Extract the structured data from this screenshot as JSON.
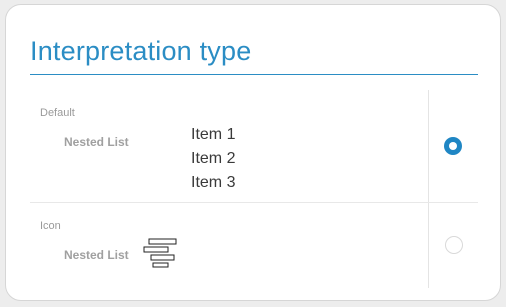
{
  "panel": {
    "title": "Interpretation type"
  },
  "options": [
    {
      "label": "Default",
      "name": "Nested List",
      "preview_items": [
        "Item 1",
        "Item 2",
        "Item 3"
      ],
      "selected": true
    },
    {
      "label": "Icon",
      "name": "Nested List",
      "preview_icon": "nested-list-icon",
      "selected": false
    }
  ],
  "colors": {
    "accent": "#2b8dc4",
    "radio_selected": "#1f86c4",
    "radio_unselected_border": "#d9d9d9"
  }
}
